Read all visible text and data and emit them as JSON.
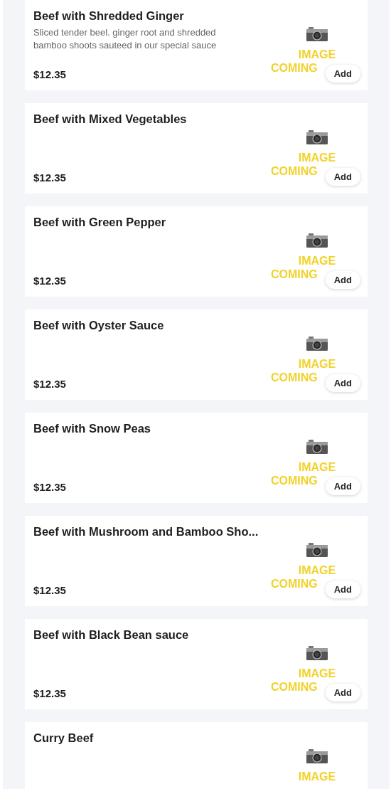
{
  "menu_items": [
    {
      "name": "Beef with Shredded Ginger",
      "description": "Sliced tender beel. ginger root and shredded bamboo shoots sauteed in our special sauce",
      "price": "$12.35",
      "image_placeholder": [
        "IMAGE",
        "COMING"
      ],
      "button": "Add"
    },
    {
      "name": "Beef with Mixed Vegetables",
      "price": "$12.35",
      "image_placeholder": [
        "IMAGE",
        "COMING"
      ],
      "button": "Add"
    },
    {
      "name": "Beef with Green Pepper",
      "price": "$12.35",
      "image_placeholder": [
        "IMAGE",
        "COMING"
      ],
      "button": "Add"
    },
    {
      "name": "Beef with Oyster Sauce",
      "price": "$12.35",
      "image_placeholder": [
        "IMAGE",
        "COMING"
      ],
      "button": "Add"
    },
    {
      "name": "Beef with Snow Peas",
      "price": "$12.35",
      "image_placeholder": [
        "IMAGE",
        "COMING"
      ],
      "button": "Add"
    },
    {
      "name": "Beef with Mushroom and Bamboo Sho...",
      "price": "$12.35",
      "image_placeholder": [
        "IMAGE",
        "COMING"
      ],
      "button": "Add"
    },
    {
      "name": "Beef with Black Bean sauce",
      "price": "$12.35",
      "image_placeholder": [
        "IMAGE",
        "COMING"
      ],
      "button": "Add"
    },
    {
      "name": "Curry Beef",
      "image_placeholder": [
        "IMAGE"
      ]
    }
  ]
}
